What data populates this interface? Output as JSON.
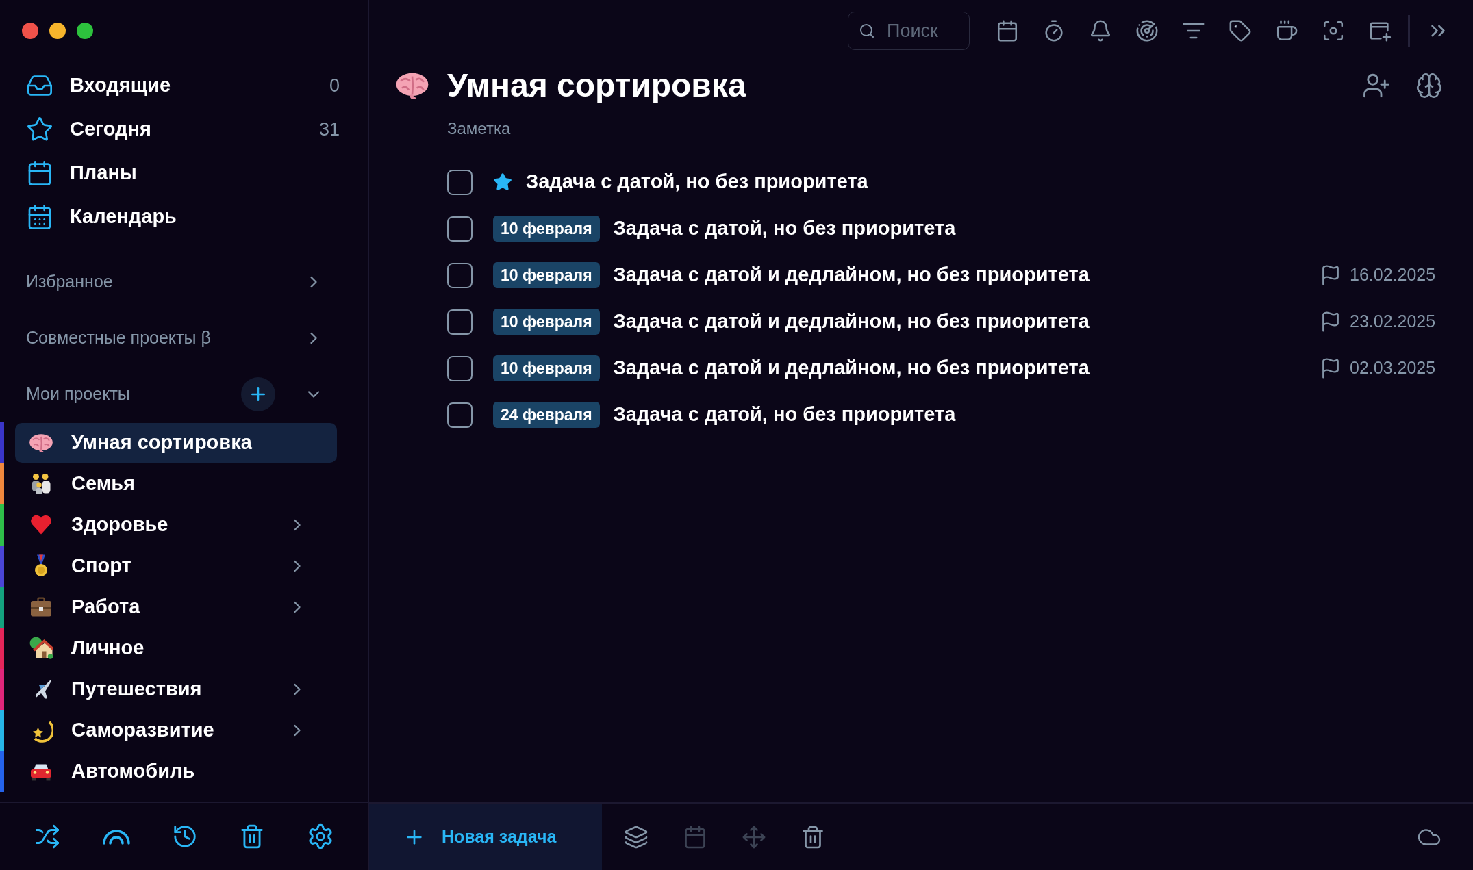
{
  "sidebar": {
    "nav": [
      {
        "label": "Входящие",
        "count": "0"
      },
      {
        "label": "Сегодня",
        "count": "31"
      },
      {
        "label": "Планы"
      },
      {
        "label": "Календарь"
      }
    ],
    "sections": [
      {
        "label": "Избранное",
        "expanded": false
      },
      {
        "label": "Совместные проекты β",
        "expanded": false
      }
    ],
    "my_projects": {
      "label": "Мои проекты",
      "expanded": true,
      "projects": [
        {
          "label": "Умная сортировка",
          "color": "#3a35c9",
          "selected": true,
          "expandable": false
        },
        {
          "label": "Семья",
          "color": "#f0883e",
          "selected": false,
          "expandable": false
        },
        {
          "label": "Здоровье",
          "color": "#2fbf4a",
          "selected": false,
          "expandable": true
        },
        {
          "label": "Спорт",
          "color": "#4b46d6",
          "selected": false,
          "expandable": true
        },
        {
          "label": "Работа",
          "color": "#14a37f",
          "selected": false,
          "expandable": true
        },
        {
          "label": "Личное",
          "color": "#e5265a",
          "selected": false,
          "expandable": false
        },
        {
          "label": "Путешествия",
          "color": "#e0267a",
          "selected": false,
          "expandable": true
        },
        {
          "label": "Саморазвитие",
          "color": "#27b6e8",
          "selected": false,
          "expandable": true
        },
        {
          "label": "Автомобиль",
          "color": "#2563eb",
          "selected": false,
          "expandable": false
        }
      ]
    }
  },
  "toolbar": {
    "search": {
      "placeholder": "Поиск"
    }
  },
  "list": {
    "title": "Умная сортировка",
    "note": "Заметка",
    "tasks": [
      {
        "checked": false,
        "starred": true,
        "text": "Задача с датой, но без приоритета"
      },
      {
        "checked": false,
        "starred": false,
        "date": "10 февраля",
        "text": "Задача с датой, но без приоритета"
      },
      {
        "checked": false,
        "starred": false,
        "date": "10 февраля",
        "text": "Задача с датой и дедлайном, но без приоритета",
        "deadline": "16.02.2025"
      },
      {
        "checked": false,
        "starred": false,
        "date": "10 февраля",
        "text": "Задача с датой и дедлайном, но без приоритета",
        "deadline": "23.02.2025"
      },
      {
        "checked": false,
        "starred": false,
        "date": "10 февраля",
        "text": "Задача с датой и дедлайном, но без приоритета",
        "deadline": "02.03.2025"
      },
      {
        "checked": false,
        "starred": false,
        "date": "24 февраля",
        "text": "Задача с датой, но без приоритета"
      }
    ]
  },
  "bottom_bar": {
    "new_task": "Новая задача",
    "actions": [
      {
        "disabled": false
      },
      {
        "disabled": true
      },
      {
        "disabled": true
      },
      {
        "disabled": false
      }
    ]
  }
}
